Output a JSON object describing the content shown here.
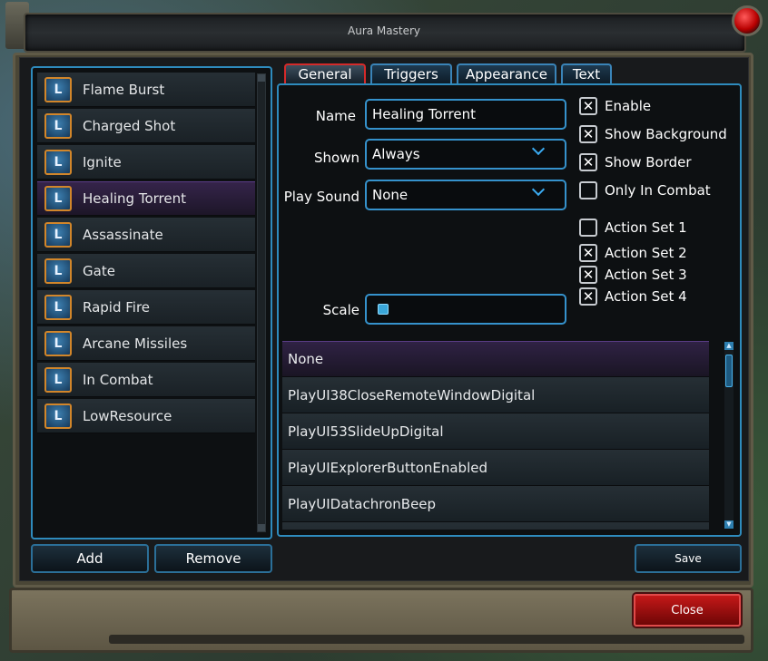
{
  "window": {
    "title": "Aura Mastery"
  },
  "aura_list": {
    "icon_letter": "L",
    "items": [
      {
        "label": "Flame Burst"
      },
      {
        "label": "Charged Shot"
      },
      {
        "label": "Ignite"
      },
      {
        "label": "Healing Torrent",
        "selected": true
      },
      {
        "label": "Assassinate"
      },
      {
        "label": "Gate"
      },
      {
        "label": "Rapid Fire"
      },
      {
        "label": "Arcane Missiles"
      },
      {
        "label": "In Combat"
      },
      {
        "label": "LowResource"
      }
    ],
    "add_label": "Add",
    "remove_label": "Remove"
  },
  "tabs": [
    {
      "label": "General",
      "active": true
    },
    {
      "label": "Triggers"
    },
    {
      "label": "Appearance"
    },
    {
      "label": "Text"
    }
  ],
  "general": {
    "name_label": "Name",
    "name_value": "Healing Torrent",
    "shown_label": "Shown",
    "shown_value": "Always",
    "sound_label": "Play Sound",
    "sound_value": "None",
    "scale_label": "Scale",
    "checkboxes": [
      {
        "label": "Enable",
        "checked": true
      },
      {
        "label": "Show Background",
        "checked": true
      },
      {
        "label": "Show Border",
        "checked": true
      },
      {
        "label": "Only In Combat",
        "checked": false
      },
      {
        "label": "Action Set 1",
        "checked": false
      },
      {
        "label": "Action Set 2",
        "checked": true
      },
      {
        "label": "Action Set 3",
        "checked": true
      },
      {
        "label": "Action Set 4",
        "checked": true
      }
    ],
    "check_mark": "✕",
    "sound_options": [
      {
        "label": "None",
        "selected": true
      },
      {
        "label": "PlayUI38CloseRemoteWindowDigital"
      },
      {
        "label": "PlayUI53SlideUpDigital"
      },
      {
        "label": "PlayUIExplorerButtonEnabled"
      },
      {
        "label": "PlayUIDatachronBeep"
      }
    ],
    "save_label": "Save"
  },
  "footer": {
    "close_label": "Close"
  },
  "colors": {
    "accent_blue": "#2e8bbd",
    "selected_purple": "#35244a",
    "close_red": "#c41818",
    "icon_border_orange": "#d2862a"
  }
}
